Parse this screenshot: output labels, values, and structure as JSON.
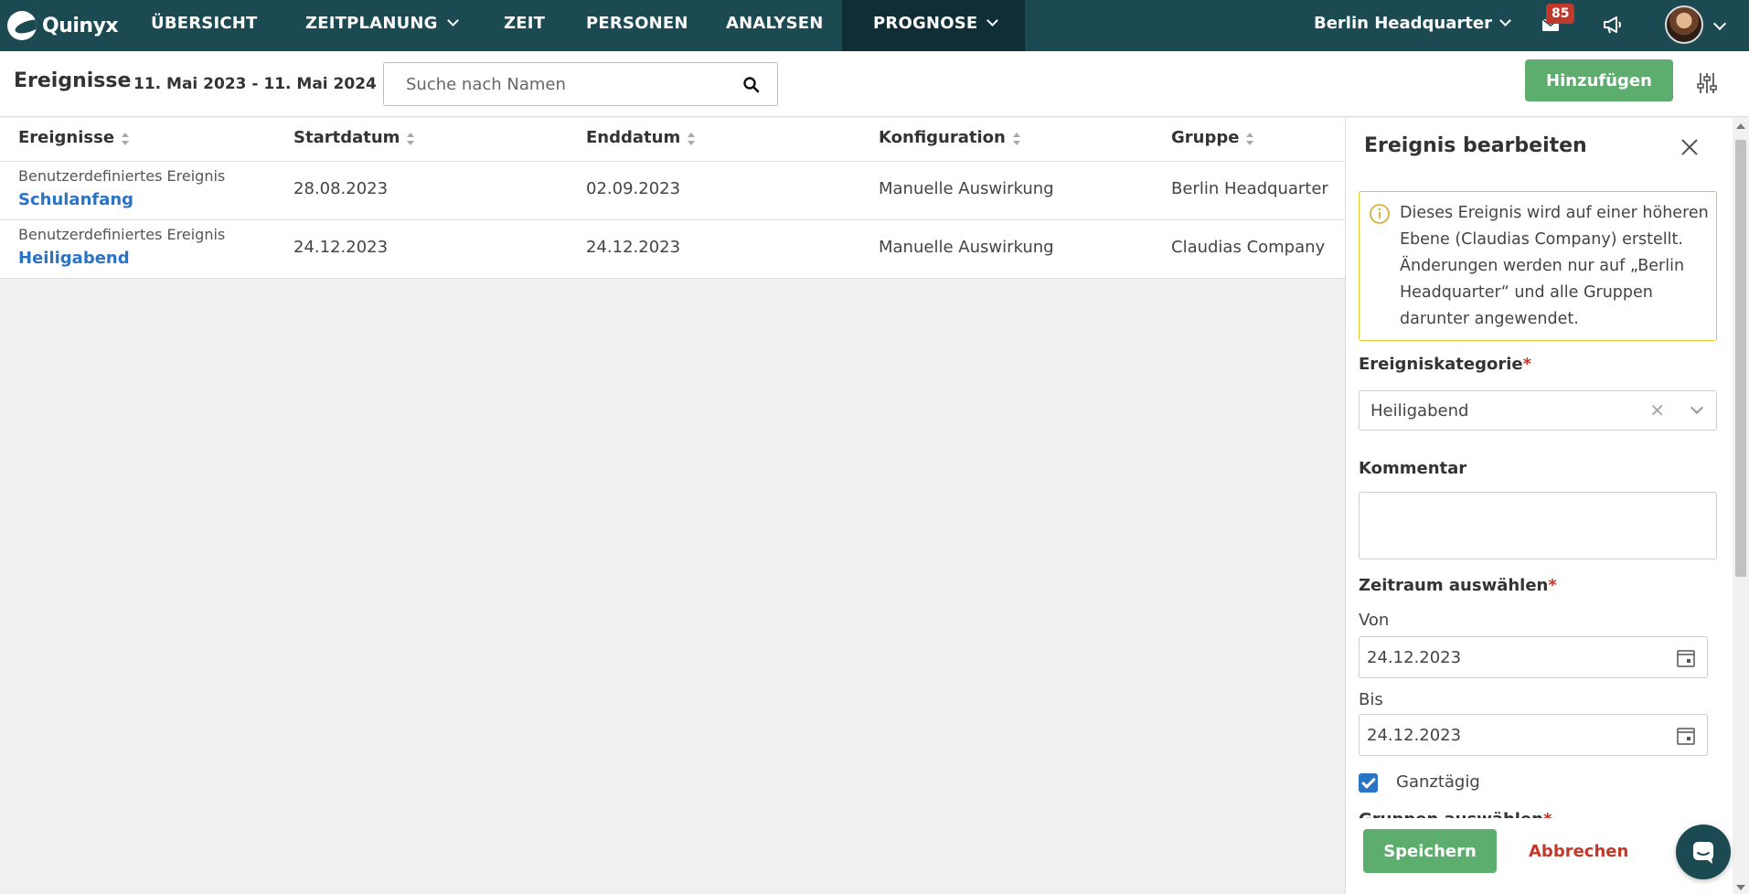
{
  "app": {
    "logo_text": "Quinyx",
    "nav": [
      {
        "label": "ÜBERSICHT"
      },
      {
        "label": "ZEITPLANUNG"
      },
      {
        "label": "ZEIT"
      },
      {
        "label": "PERSONEN"
      },
      {
        "label": "ANALYSEN"
      },
      {
        "label": "PROGNOSE"
      }
    ],
    "unit": "Berlin Headquarter",
    "notification_count": "85",
    "brand_color": "#1c4a53",
    "active_nav_color": "#0f2e35"
  },
  "header": {
    "title": "Ereignisse",
    "date_range": "11. Mai 2023 - 11. Mai 2024",
    "search_placeholder": "Suche nach Namen",
    "add_label": "Hinzufügen",
    "add_color": "#5cad6e"
  },
  "table": {
    "columns": [
      "Ereignisse",
      "Startdatum",
      "Enddatum",
      "Konfiguration",
      "Gruppe"
    ],
    "rows": [
      {
        "type": "Benutzerdefiniertes Ereignis",
        "name": "Schulanfang",
        "start": "28.08.2023",
        "end": "02.09.2023",
        "config": "Manuelle Auswirkung",
        "group": "Berlin Headquarter"
      },
      {
        "type": "Benutzerdefiniertes Ereignis",
        "name": "Heiligabend",
        "start": "24.12.2023",
        "end": "24.12.2023",
        "config": "Manuelle Auswirkung",
        "group": "Claudias Company"
      }
    ],
    "link_color": "#2b73c4"
  },
  "panel": {
    "title": "Ereignis bearbeiten",
    "info": "Dieses Ereignis wird auf einer höheren Ebene (Claudias Company) erstellt. Änderungen werden nur auf „Berlin Headquarter“ und alle Gruppen darunter angewendet.",
    "category_label": "Ereigniskategorie",
    "category_value": "Heiligabend",
    "comment_label": "Kommentar",
    "period_label": "Zeitraum auswählen",
    "from_label": "Von",
    "from_value": "24.12.2023",
    "to_label": "Bis",
    "to_value": "24.12.2023",
    "all_day_label": "Ganztägig",
    "all_day_checked": true,
    "groups_label": "Gruppen auswählen",
    "required_mark": "*",
    "save_label": "Speichern",
    "cancel_label": "Abbrechen",
    "cancel_color": "#c0392b"
  }
}
